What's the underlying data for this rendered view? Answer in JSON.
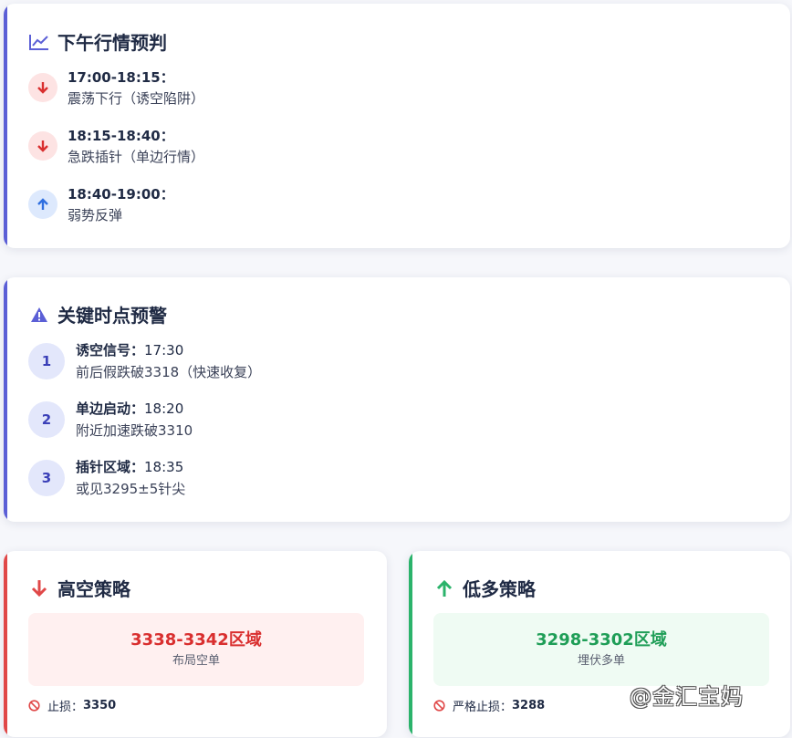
{
  "forecast": {
    "title": "下午行情预判",
    "items": [
      {
        "time": "17:00-18:15：",
        "desc": "震荡下行（诱空陷阱）",
        "direction": "down"
      },
      {
        "time": "18:15-18:40：",
        "desc": "急跌插针（单边行情）",
        "direction": "down"
      },
      {
        "time": "18:40-19:00：",
        "desc": "弱势反弹",
        "direction": "up"
      }
    ]
  },
  "alerts": {
    "title": "关键时点预警",
    "items": [
      {
        "num": "1",
        "label": "诱空信号：",
        "time": "17:30",
        "desc": "前后假跌破3318（快速收复）"
      },
      {
        "num": "2",
        "label": "单边启动：",
        "time": "18:20",
        "desc": "附近加速跌破3310"
      },
      {
        "num": "3",
        "label": "插针区域：",
        "time": "18:35",
        "desc": "或见3295±5针尖"
      }
    ]
  },
  "short_strategy": {
    "title": "高空策略",
    "zone": "3338-3342区域",
    "zone_sub": "布局空单",
    "stop_label": "止损：",
    "stop_value": "3350"
  },
  "long_strategy": {
    "title": "低多策略",
    "zone": "3298-3302区域",
    "zone_sub": "埋伏多单",
    "stop_label": "严格止损：",
    "stop_value": "3288"
  },
  "watermark": "@金汇宝妈",
  "colors": {
    "indigo": "#5b5fd6",
    "red": "#e04848",
    "green": "#2bb36b",
    "blue": "#2f6fe0"
  }
}
